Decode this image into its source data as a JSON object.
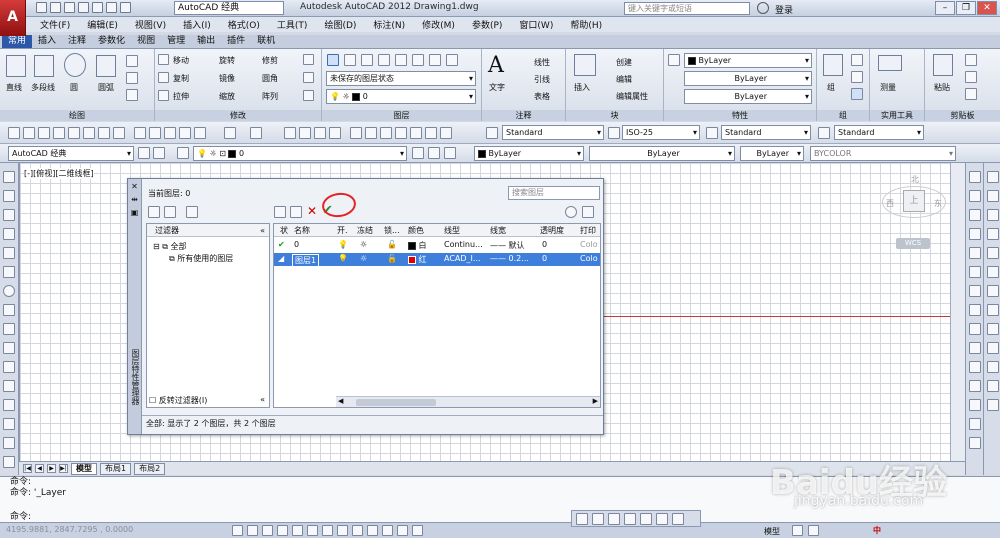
{
  "app": {
    "workspace": "AutoCAD 经典",
    "title": "Autodesk AutoCAD 2012   Drawing1.dwg",
    "search_placeholder": "键入关键字或短语",
    "login": "登录"
  },
  "menus": [
    "文件(F)",
    "编辑(E)",
    "视图(V)",
    "插入(I)",
    "格式(O)",
    "工具(T)",
    "绘图(D)",
    "标注(N)",
    "修改(M)",
    "参数(P)",
    "窗口(W)",
    "帮助(H)"
  ],
  "ribbon_tabs": [
    "常用",
    "插入",
    "注释",
    "参数化",
    "视图",
    "管理",
    "输出",
    "插件",
    "联机"
  ],
  "ribbon": {
    "draw": {
      "title": "绘图",
      "line": "直线",
      "polyline": "多段线",
      "circle": "圆",
      "arc": "圆弧"
    },
    "modify": {
      "title": "修改",
      "move": "移动",
      "rotate": "旋转",
      "trim": "修剪",
      "copy": "复制",
      "mirror": "镜像",
      "fillet": "圆角",
      "stretch": "拉伸",
      "scale": "缩放",
      "array": "阵列"
    },
    "layers": {
      "title": "图层",
      "state": "未保存的图层状态",
      "current": "0"
    },
    "annotation": {
      "title": "注释",
      "text": "文字",
      "linear": "线性",
      "leader": "引线",
      "table": "表格"
    },
    "block": {
      "title": "块",
      "insert": "插入",
      "create": "创建",
      "edit": "编辑",
      "attr": "编辑属性"
    },
    "properties": {
      "title": "特性",
      "color": "ByLayer",
      "linetype": "ByLayer",
      "lineweight": "ByLayer"
    },
    "groups": {
      "title": "组",
      "group": "组"
    },
    "utilities": {
      "title": "实用工具",
      "measure": "测量"
    },
    "clipboard": {
      "title": "剪贴板",
      "paste": "粘贴"
    }
  },
  "toolbar": {
    "text_style": "Standard",
    "dim_style": "ISO-25",
    "table_style": "Standard",
    "mleader_style": "Standard"
  },
  "toolbar2": {
    "workspace": "AutoCAD 经典",
    "layer": "0",
    "color": "ByLayer",
    "linetype": "ByLayer",
    "lineweight": "ByLayer",
    "plotstyle": "BYCOLOR"
  },
  "viewport_label": "[-][俯视][二维线框]",
  "viewcube": {
    "north": "北",
    "west": "西",
    "east": "东",
    "top": "上",
    "wcs": "WCS"
  },
  "layer_palette": {
    "current_layer": "当前图层: 0",
    "search_placeholder": "搜索图层",
    "side_title": "图层特性管理器",
    "filters_header": "过滤器",
    "tree_all": "全部",
    "tree_used": "所有使用的图层",
    "invert_filter": "反转过滤器(I)",
    "columns": [
      "状",
      "名称",
      "开.",
      "冻结",
      "锁...",
      "颜色",
      "线型",
      "线宽",
      "透明度",
      "打印"
    ],
    "rows": [
      {
        "name": "0",
        "color": "白",
        "linetype": "Continu...",
        "lineweight": "默认",
        "transparency": "0",
        "plot": "Colo"
      },
      {
        "name": "图层1",
        "color": "红",
        "linetype": "ACAD_I...",
        "lineweight": "0.2...",
        "transparency": "0",
        "plot": "Colo"
      }
    ],
    "status": "全部: 显示了 2 个图层，共 2 个图层"
  },
  "layout_tabs": [
    "模型",
    "布局1",
    "布局2"
  ],
  "command_lines": [
    "命令:",
    "命令: '_Layer",
    "命令:"
  ],
  "status_bar": {
    "coords": "4195.9881, 2847.7295 , 0.0000",
    "mode": "模型",
    "ime": "中"
  },
  "watermark": {
    "brand": "Baidu经验",
    "url": "jingyan.baidu.com"
  },
  "colors": {
    "accent": "#2d57a8",
    "selection": "#3f7fdc",
    "annotation_circle": "#e32424",
    "red_layer": "#e00000"
  }
}
